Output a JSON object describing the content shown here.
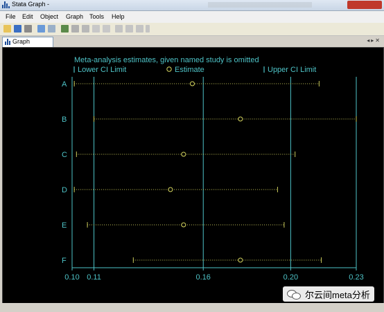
{
  "window": {
    "title": "Stata Graph -"
  },
  "menu": [
    "File",
    "Edit",
    "Object",
    "Graph",
    "Tools",
    "Help"
  ],
  "tab": {
    "label": "Graph"
  },
  "chart_data": {
    "type": "scatter",
    "title": "Meta-analysis estimates, given named study is omitted",
    "legend": {
      "placement": "top",
      "entries": [
        "Lower CI Limit",
        "Estimate",
        "Upper CI Limit"
      ]
    },
    "studies": [
      "A",
      "B",
      "C",
      "D",
      "E",
      "F"
    ],
    "estimate": [
      0.155,
      0.177,
      0.151,
      0.145,
      0.151,
      0.177
    ],
    "lower_ci": [
      0.101,
      0.11,
      0.102,
      0.101,
      0.107,
      0.128
    ],
    "upper_ci": [
      0.213,
      0.23,
      0.202,
      0.194,
      0.197,
      0.214
    ],
    "reference_lines": [
      0.1,
      0.11,
      0.16,
      0.2,
      0.23
    ],
    "xticks": [
      "0.10",
      "0.11",
      "0.16",
      "0.20",
      "0.23"
    ],
    "xlim": [
      0.1,
      0.23
    ],
    "colors": {
      "axis_text": "#4ec3c7",
      "ci_dots": "#c8c85a",
      "estimate": "#d8d860",
      "background": "#000000"
    }
  },
  "watermark": {
    "text": "尔云间meta分析"
  }
}
